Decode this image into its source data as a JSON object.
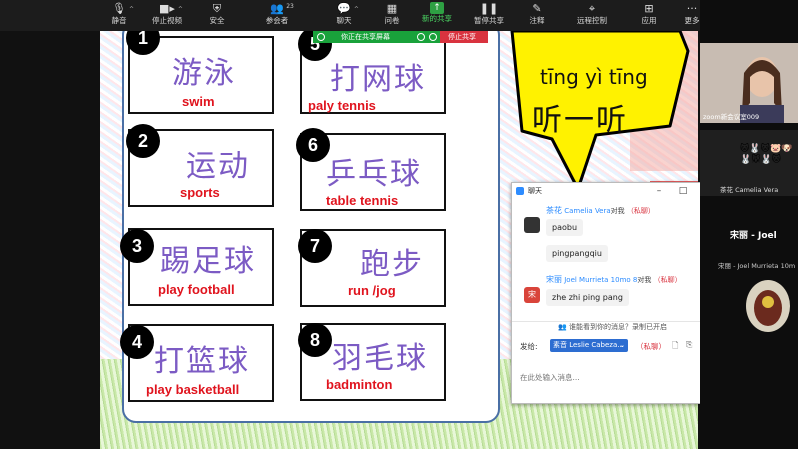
{
  "toolbar": {
    "items": [
      {
        "label": "静音",
        "icon": "microphone-icon"
      },
      {
        "label": "停止视频",
        "icon": "video-camera-icon"
      },
      {
        "label": "安全",
        "icon": "shield-icon"
      },
      {
        "label": "参会者",
        "icon": "participants-icon",
        "count": "23"
      },
      {
        "label": "聊天",
        "icon": "chat-bubble-icon"
      },
      {
        "label": "问卷",
        "icon": "poll-icon"
      },
      {
        "label": "新的共享",
        "icon": "share-screen-icon"
      },
      {
        "label": "暂停共享",
        "icon": "pause-icon"
      },
      {
        "label": "注释",
        "icon": "annotate-pen-icon"
      },
      {
        "label": "远程控制",
        "icon": "remote-control-icon"
      },
      {
        "label": "应用",
        "icon": "apps-icon"
      },
      {
        "label": "更多",
        "icon": "more-dots-icon"
      }
    ],
    "active_color": "#2ea043"
  },
  "share_bar": {
    "status": "你正在共享屏幕",
    "stop": "停止共享"
  },
  "slide": {
    "cards": [
      {
        "num": "1",
        "hanzi": "游泳",
        "en": "swim"
      },
      {
        "num": "2",
        "hanzi": "运动",
        "en": "sports"
      },
      {
        "num": "3",
        "hanzi": "踢足球",
        "en": "play football"
      },
      {
        "num": "4",
        "hanzi": "打篮球",
        "en": "play basketball"
      },
      {
        "num": "5",
        "hanzi": "打网球",
        "en": "paly tennis"
      },
      {
        "num": "6",
        "hanzi": "乒乓球",
        "en": "table tennis"
      },
      {
        "num": "7",
        "hanzi": "跑步",
        "en": "run /jog"
      },
      {
        "num": "8",
        "hanzi": "羽毛球",
        "en": "badminton"
      }
    ],
    "bubble_pinyin": "tīng yì tīng",
    "bubble_hanzi": "听一听",
    "hanzi_color": "#7c5bc4",
    "en_color": "#e0141e"
  },
  "chat": {
    "title": "聊天",
    "messages": [
      {
        "sender_cn": "茶花",
        "sender_en": "Camelia Vera",
        "to": "对我",
        "private": "（私聊）",
        "lines": [
          "paobu",
          "pingpangqiu"
        ]
      },
      {
        "sender_cn": "宋丽",
        "sender_en": "Joel Murrieta 10mo 8",
        "to": "对我",
        "private": "（私聊）",
        "lines": [
          "zhe zhi ping pang"
        ]
      }
    ],
    "avatar_label": "宋",
    "notice": "谁能看到你的消息？录制已开启",
    "send_to_label": "发给:",
    "send_to_value": "素音 Leslie Cabeza...",
    "private_tag": "（私聊）",
    "input_placeholder": "在此处输入消息..."
  },
  "side": {
    "tile1_label": "zoom新会议室009",
    "tile2_label": "茶花 Camelia Vera",
    "tile3_name": "宋丽 - Joel",
    "tile3_sub": "宋丽 - Joel Murrieta 10m",
    "emoji": "🐱🐰🐱🐷🐶🐰🐭🐰🐱"
  }
}
